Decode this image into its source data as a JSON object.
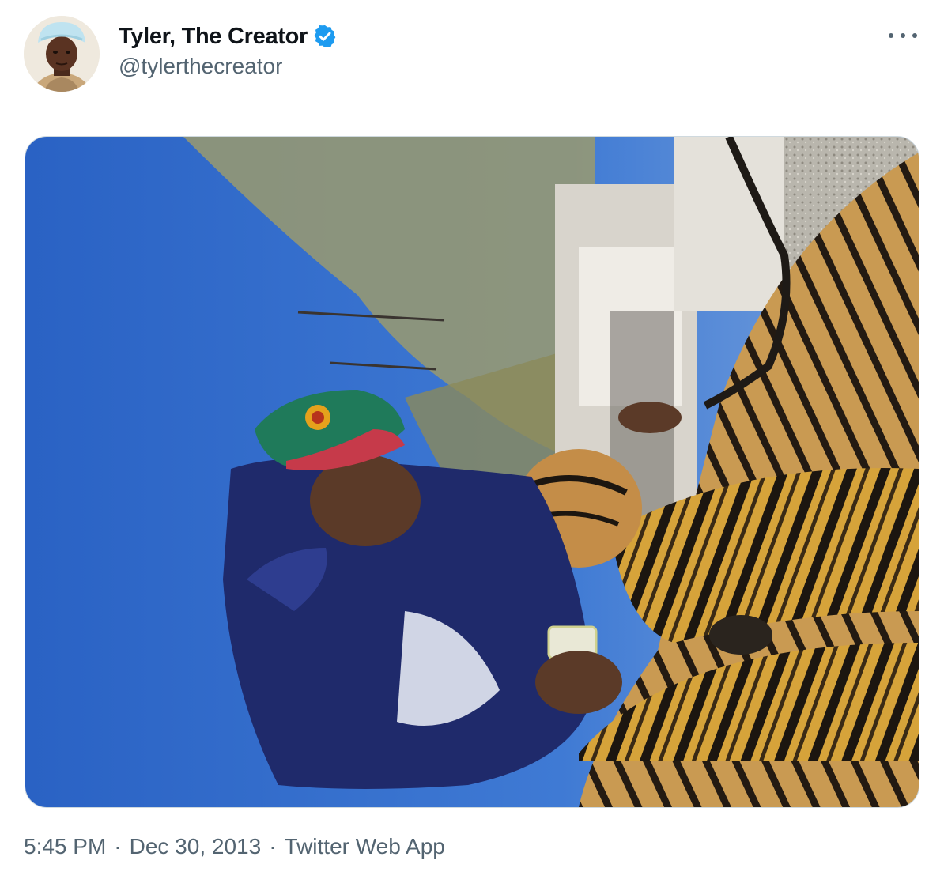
{
  "author": {
    "display_name": "Tyler, The Creator",
    "handle": "@tylerthecreator",
    "verified": true
  },
  "colors": {
    "verified_badge": "#1d9bf0",
    "secondary_text": "#536471",
    "border": "#cfd9de"
  },
  "icons": {
    "verified": "verified-badge-icon",
    "more": "more-options-icon"
  },
  "meta": {
    "time": "5:45 PM",
    "separator": "·",
    "date": "Dec 30, 2013",
    "source": "Twitter Web App"
  }
}
